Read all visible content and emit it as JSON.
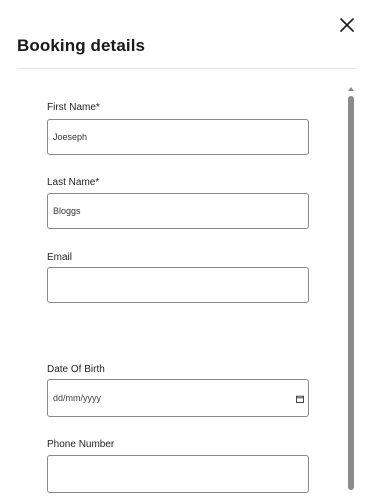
{
  "dialog": {
    "title": "Booking details",
    "close_icon": "close-icon"
  },
  "form": {
    "first_name": {
      "label": "First Name*",
      "value": "Joeseph"
    },
    "last_name": {
      "label": "Last Name*",
      "value": "Bloggs"
    },
    "email": {
      "label": "Email",
      "value": ""
    },
    "date_of_birth": {
      "label": "Date Of Birth",
      "placeholder": "dd/mm/yyyy",
      "icon": "calendar-icon"
    },
    "phone_number": {
      "label": "Phone Number",
      "value": ""
    }
  },
  "colors": {
    "border": "#8a8a8a",
    "divider": "#e4e4e4",
    "scrollbar": "#8a8a8a"
  }
}
